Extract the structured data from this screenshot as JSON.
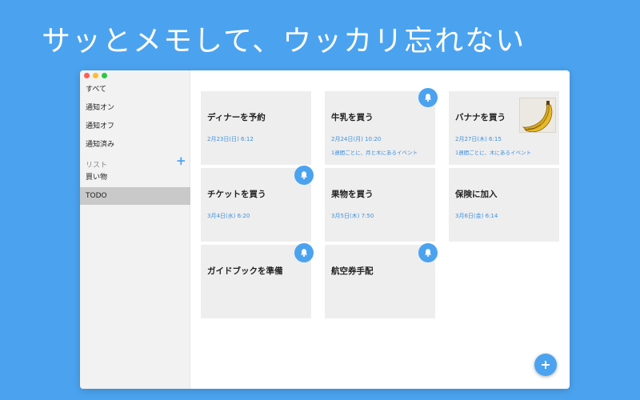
{
  "headline": "サッとメモして、ウッカリ忘れない",
  "sidebar": {
    "filters": [
      "すべて",
      "通知オン",
      "通知オフ",
      "通知済み"
    ],
    "list_section_label": "リスト",
    "add_list_label": "+",
    "lists": [
      "買い物",
      "TODO"
    ],
    "selected_list": "TODO"
  },
  "cards": [
    {
      "title": "ディナーを予約",
      "date": "2月23日(日) 6:12",
      "repeat": "",
      "bell": false,
      "image": false
    },
    {
      "title": "牛乳を買う",
      "date": "2月24日(月) 10:20",
      "repeat": "1週間ごとに、月と木にあるイベント",
      "bell": true,
      "image": false
    },
    {
      "title": "バナナを買う",
      "date": "2月27日(木) 6:15",
      "repeat": "1週間ごとに、木にあるイベント",
      "bell": false,
      "image": true
    },
    {
      "title": "チケットを買う",
      "date": "3月4日(水) 6:20",
      "repeat": "",
      "bell": true,
      "image": false
    },
    {
      "title": "果物を買う",
      "date": "3月5日(木) 7:50",
      "repeat": "",
      "bell": false,
      "image": false
    },
    {
      "title": "保険に加入",
      "date": "3月6日(金) 6:14",
      "repeat": "",
      "bell": false,
      "image": false
    },
    {
      "title": "ガイドブックを準備",
      "date": "",
      "repeat": "",
      "bell": true,
      "image": false
    },
    {
      "title": "航空券手配",
      "date": "",
      "repeat": "",
      "bell": true,
      "image": false
    }
  ],
  "fab_label": "+",
  "colors": {
    "background": "#4ba3ef",
    "accent": "#4ba3ef",
    "date_text": "#3d8fdc",
    "card": "#eeeeee",
    "sidebar_selected": "#c9c9c9"
  },
  "icons": {
    "reminder": "bell-icon",
    "image": "banana-photo",
    "add": "plus-icon"
  }
}
